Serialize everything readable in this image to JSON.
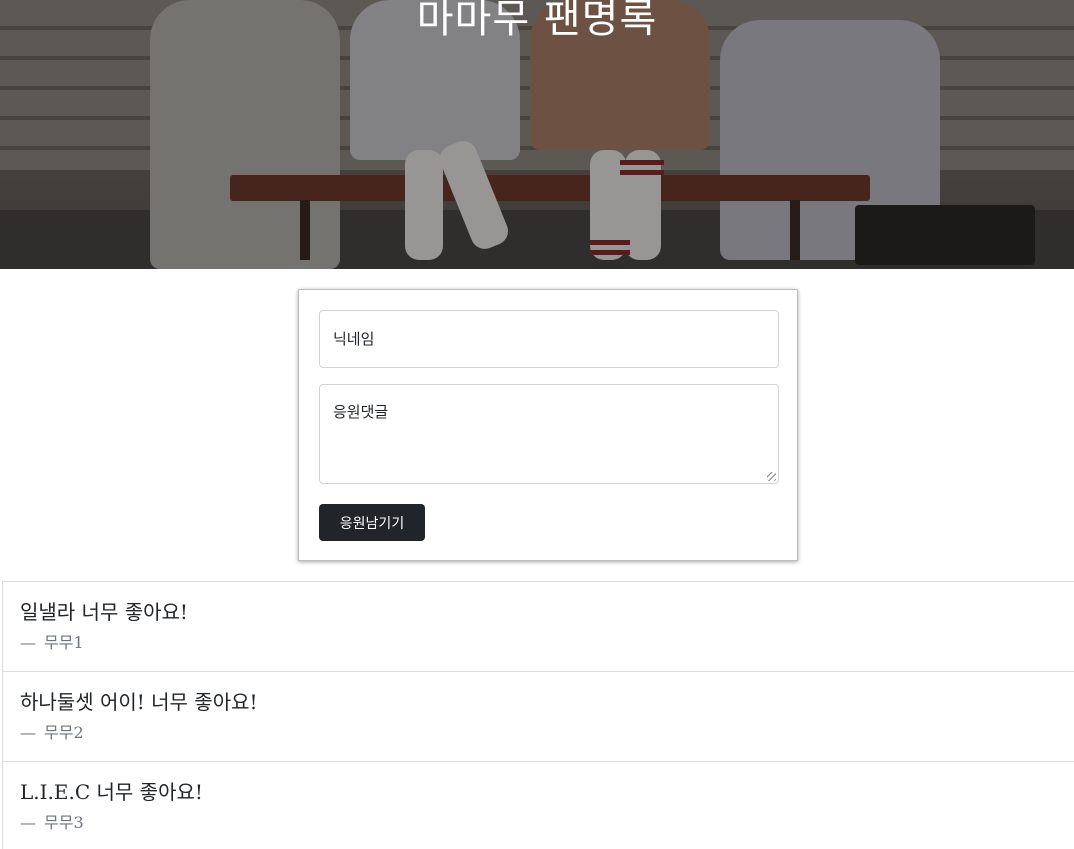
{
  "hero": {
    "title": "마마무 팬명록"
  },
  "form": {
    "nickname_placeholder": "닉네임",
    "comment_placeholder": "응원댓글",
    "submit_label": "응원남기기"
  },
  "comments": [
    {
      "text": "일낼라 너무 좋아요!",
      "dash": "—",
      "author": "무무1"
    },
    {
      "text": "하나둘셋 어이! 너무 좋아요!",
      "dash": "—",
      "author": "무무2"
    },
    {
      "text": "L.I.E.C 너무 좋아요!",
      "dash": "—",
      "author": "무무3"
    }
  ],
  "colors": {
    "button_bg": "#212529",
    "author_text": "#6c757d"
  }
}
